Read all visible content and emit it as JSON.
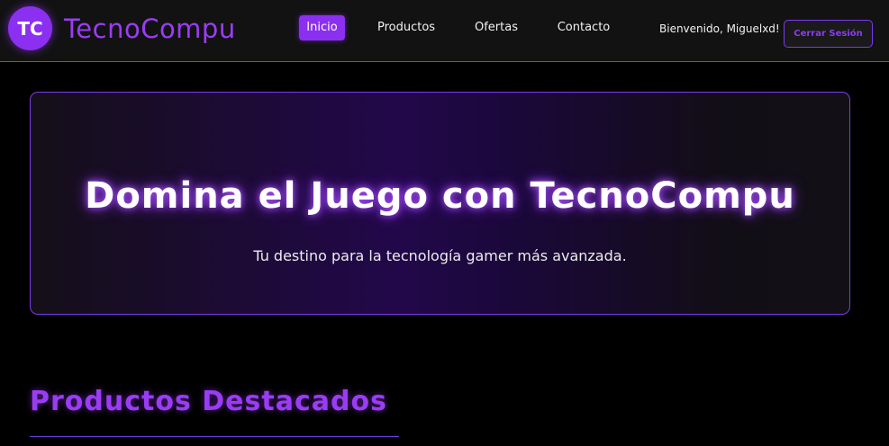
{
  "header": {
    "logo_initials": "TC",
    "brand_name": "TecnoCompu",
    "nav": [
      {
        "label": "Inicio",
        "active": true
      },
      {
        "label": "Productos",
        "active": false
      },
      {
        "label": "Ofertas",
        "active": false
      },
      {
        "label": "Contacto",
        "active": false
      }
    ],
    "welcome": "Bienvenido, Miguelxd!",
    "logout_label": "Cerrar Sesión"
  },
  "hero": {
    "title": "Domina el Juego con TecnoCompu",
    "subtitle": "Tu destino para la tecnología gamer más avanzada."
  },
  "featured": {
    "title": "Productos Destacados"
  },
  "colors": {
    "accent": "#8b2ff0",
    "accent_text": "#9b3cf5",
    "background": "#000000",
    "navbar_bg": "#121212"
  }
}
